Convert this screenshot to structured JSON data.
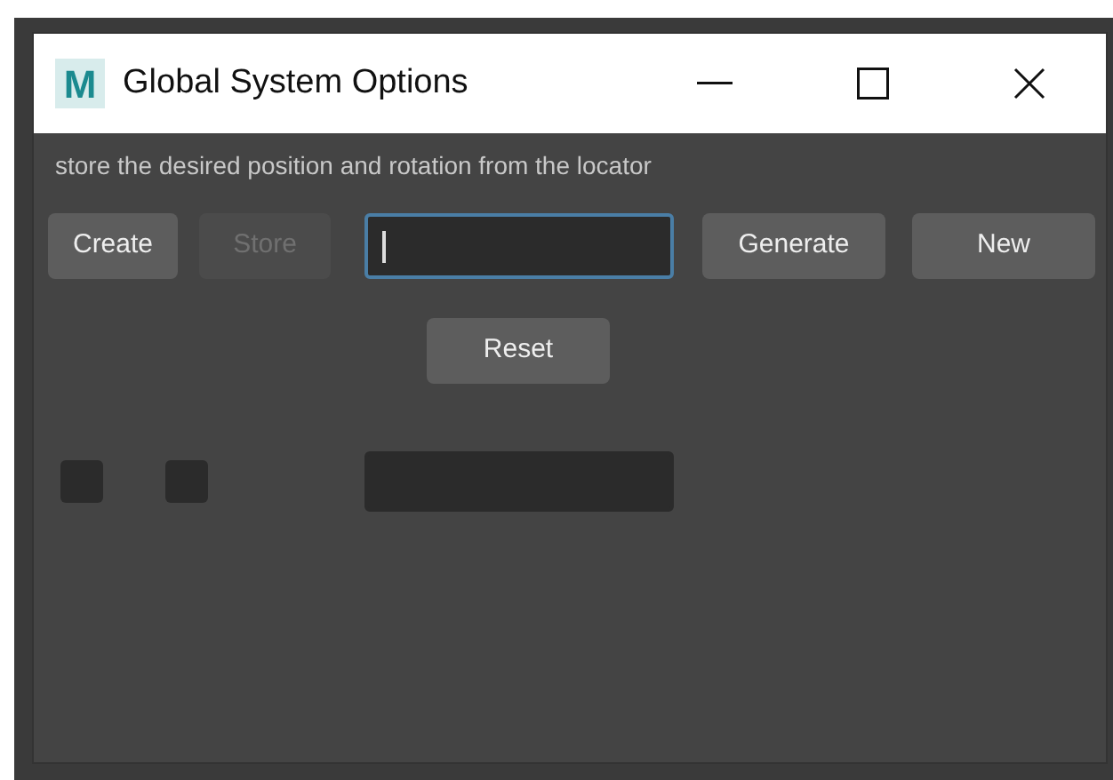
{
  "window": {
    "logo": "M",
    "title": "Global System Options"
  },
  "description": "store the desired position and rotation from the locator",
  "row_1": [
    {
      "kind": "button",
      "label": "Create",
      "disabled": false
    },
    {
      "kind": "button",
      "label": "Store",
      "disabled": true
    },
    {
      "kind": "field",
      "focused": true
    },
    {
      "kind": "button",
      "label": "Generate",
      "disabled": false
    },
    {
      "kind": "button",
      "label": "New",
      "disabled": false
    }
  ],
  "reset_button": {
    "label": "Reset",
    "disabled": false
  },
  "row_3": [
    {
      "kind": "checkbox",
      "checked": false
    },
    {
      "kind": "checkbox",
      "checked": false
    },
    {
      "kind": "field",
      "focused": false
    }
  ]
}
